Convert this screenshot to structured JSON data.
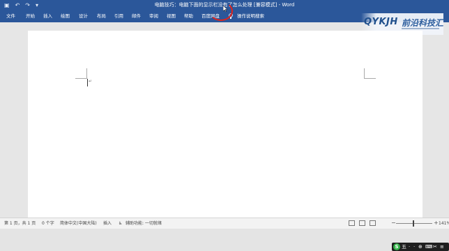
{
  "window": {
    "title": "电脑技巧：电脑下面的显示栏没有了怎么处理 [兼容模式] - Word",
    "qat": {
      "save_icon": "save-icon",
      "undo_icon": "undo-icon",
      "redo_icon": "redo-icon",
      "customize_icon": "customize-qat-icon"
    }
  },
  "ribbon": {
    "tabs": [
      "文件",
      "开始",
      "插入",
      "绘图",
      "设计",
      "布局",
      "引用",
      "邮件",
      "审阅",
      "视图",
      "帮助",
      "百度网盘"
    ],
    "tell_me": "操作说明搜索"
  },
  "logo": {
    "mark": "QYKJH",
    "name": "前沿科技汇"
  },
  "status": {
    "page": "第 1 页，共 1 页",
    "words": "0 个字",
    "language": "简体中文(中国大陆)",
    "mode": "插入",
    "accessibility": "辅助功能: 一切就绪",
    "zoom": "141%"
  },
  "ime": {
    "logo": "S",
    "items": [
      "五",
      "·",
      "·",
      "⊕",
      "⌨",
      "✂",
      "≡"
    ]
  },
  "colors": {
    "ribbon": "#2b579a",
    "annotation_circle": "#e2231a"
  }
}
